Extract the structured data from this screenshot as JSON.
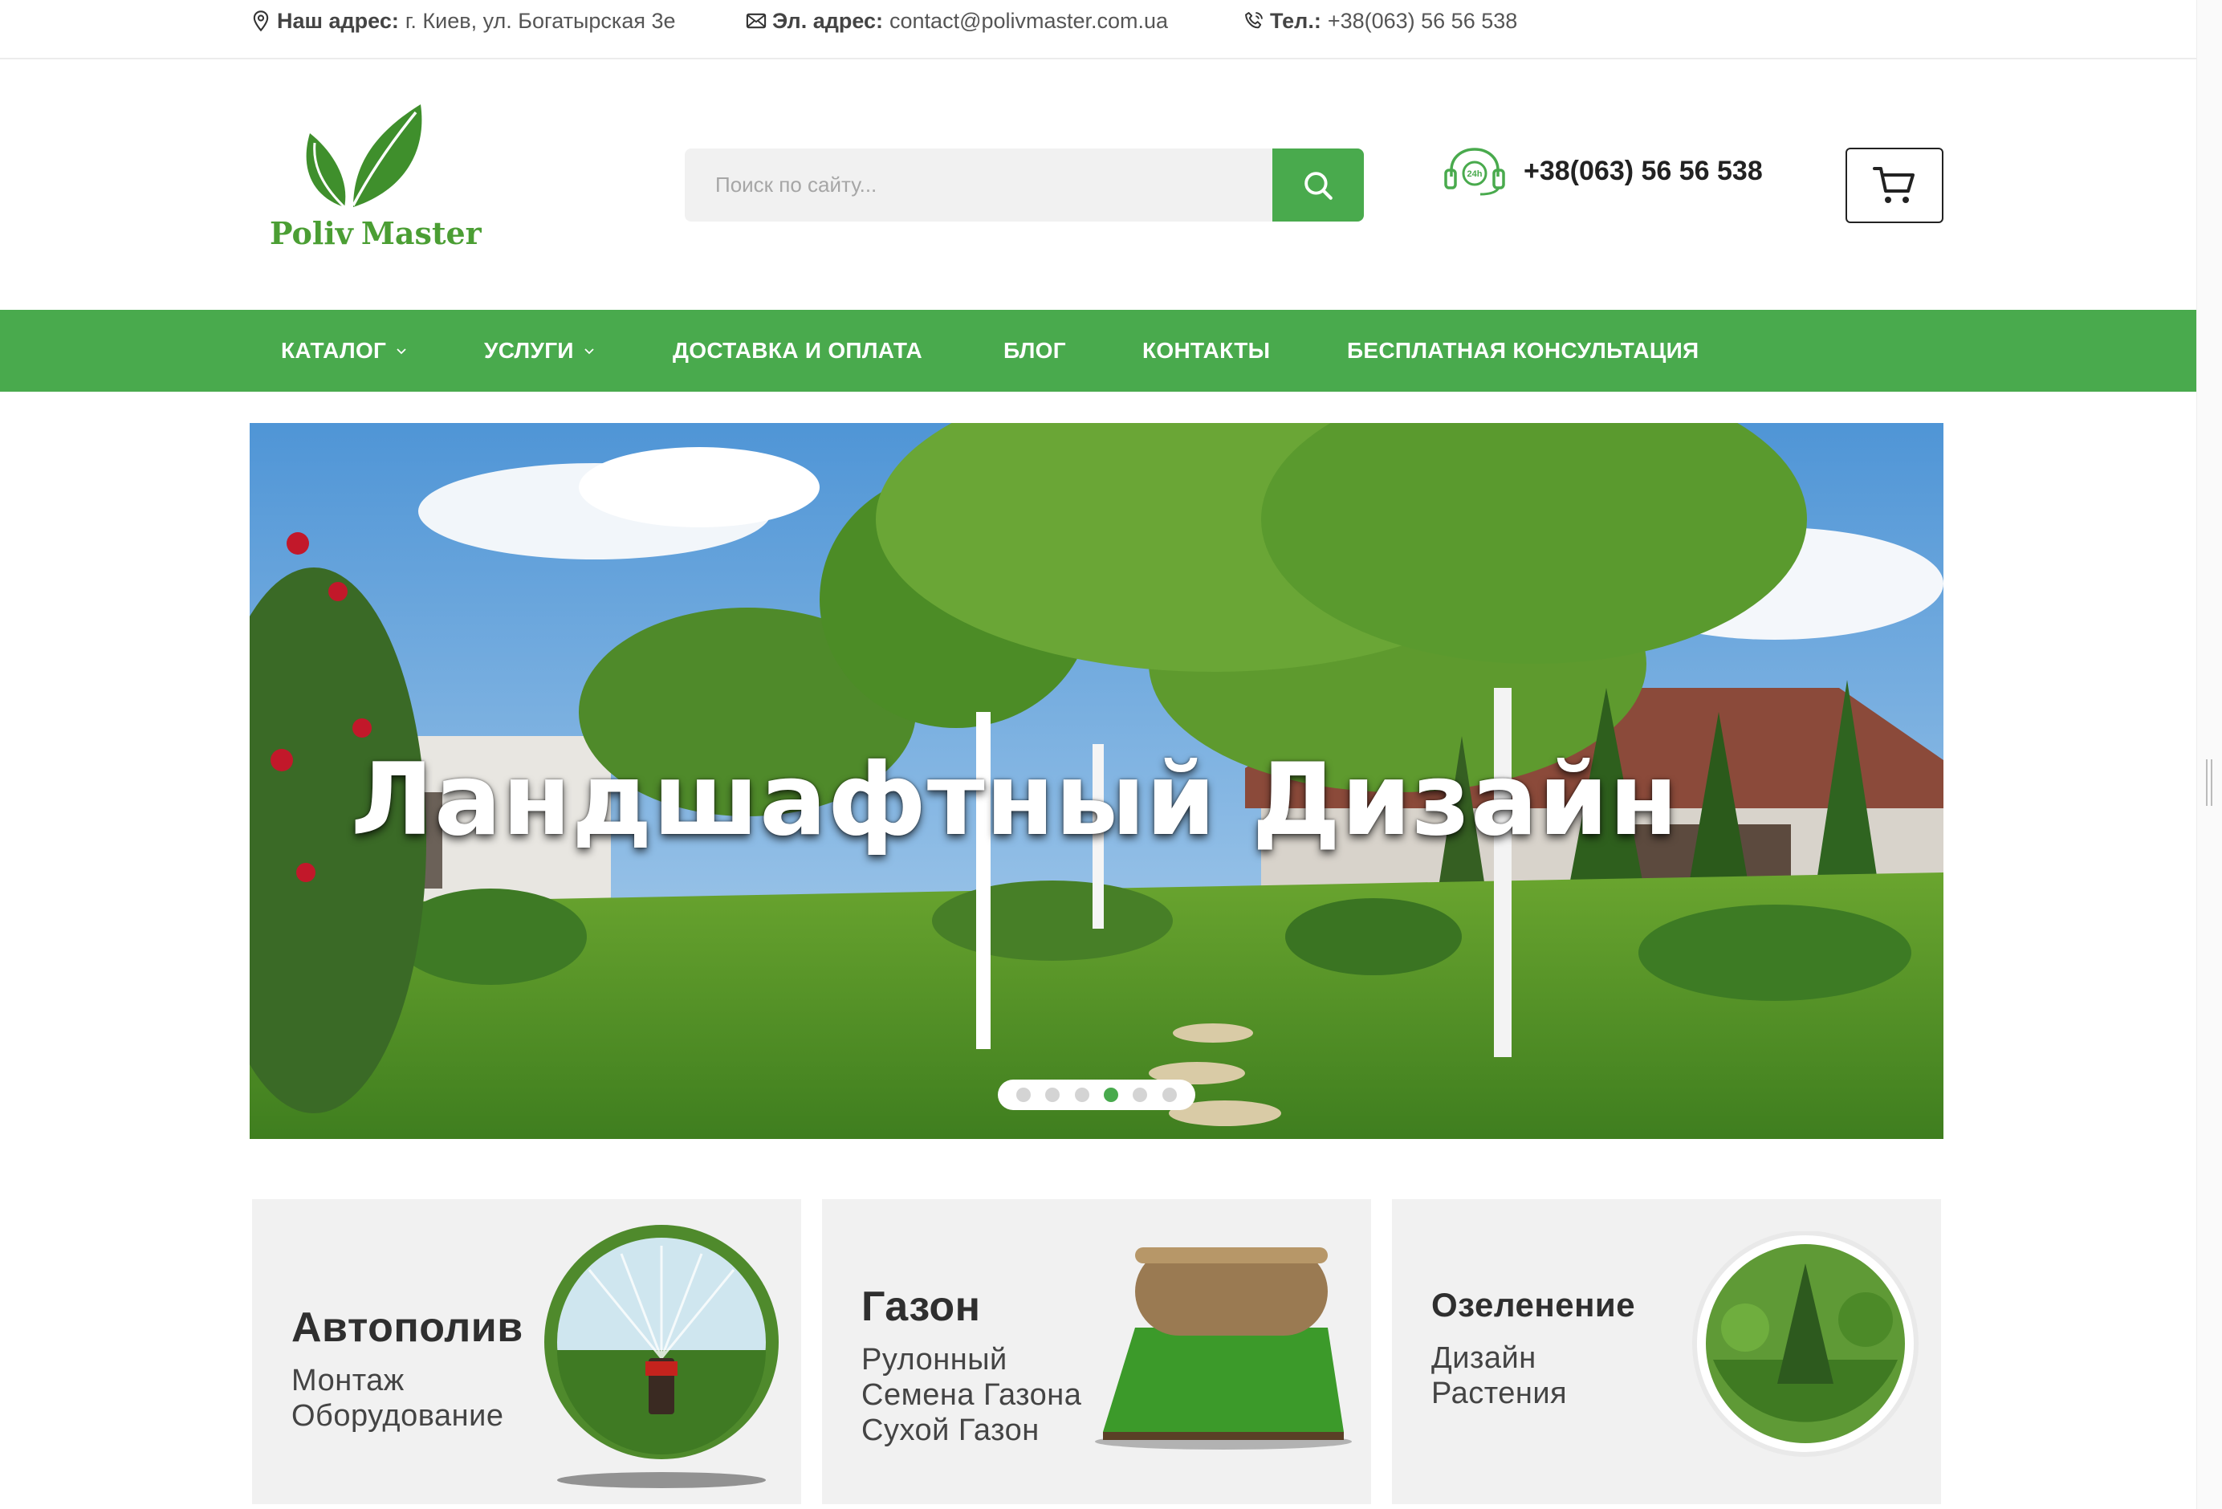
{
  "topbar": {
    "address_label": "Наш адрес:",
    "address_value": "г. Киев, ул. Богатырская 3е",
    "email_label": "Эл. адрес:",
    "email_value": "contact@polivmaster.com.ua",
    "phone_label": "Тел.:",
    "phone_value": "+38(063) 56 56 538"
  },
  "header": {
    "logo_word1": "Poliv",
    "logo_word2": "Master",
    "search_placeholder": "Поиск по сайту...",
    "phone_badge": "24h",
    "phone": "+38(063) 56 56 538"
  },
  "nav": {
    "items": [
      {
        "label": "Каталог",
        "has_dropdown": true
      },
      {
        "label": "Услуги",
        "has_dropdown": true
      },
      {
        "label": "Доставка и оплата",
        "has_dropdown": false
      },
      {
        "label": "Блог",
        "has_dropdown": false
      },
      {
        "label": "Контакты",
        "has_dropdown": false
      },
      {
        "label": "Бесплатная консультация",
        "has_dropdown": false
      }
    ]
  },
  "hero": {
    "title": "Ландшафтный Дизайн",
    "slides_count": 6,
    "active_slide": 4
  },
  "cards": [
    {
      "title": "Автополив",
      "lines": [
        "Монтаж",
        "Оборудование"
      ]
    },
    {
      "title": "Газон",
      "lines": [
        "Рулонный",
        "Семена Газона",
        "Сухой Газон"
      ]
    },
    {
      "title": "Озеленение",
      "lines": [
        "Дизайн",
        "Растения"
      ]
    }
  ],
  "colors": {
    "brand_green": "#49aa4d",
    "logo_green": "#4b9e34",
    "card_bg": "#f1f1f1"
  },
  "icons": [
    "location-pin-icon",
    "envelope-icon",
    "phone-icon",
    "search-icon",
    "headset-24h-icon",
    "cart-icon",
    "chevron-down-icon"
  ]
}
